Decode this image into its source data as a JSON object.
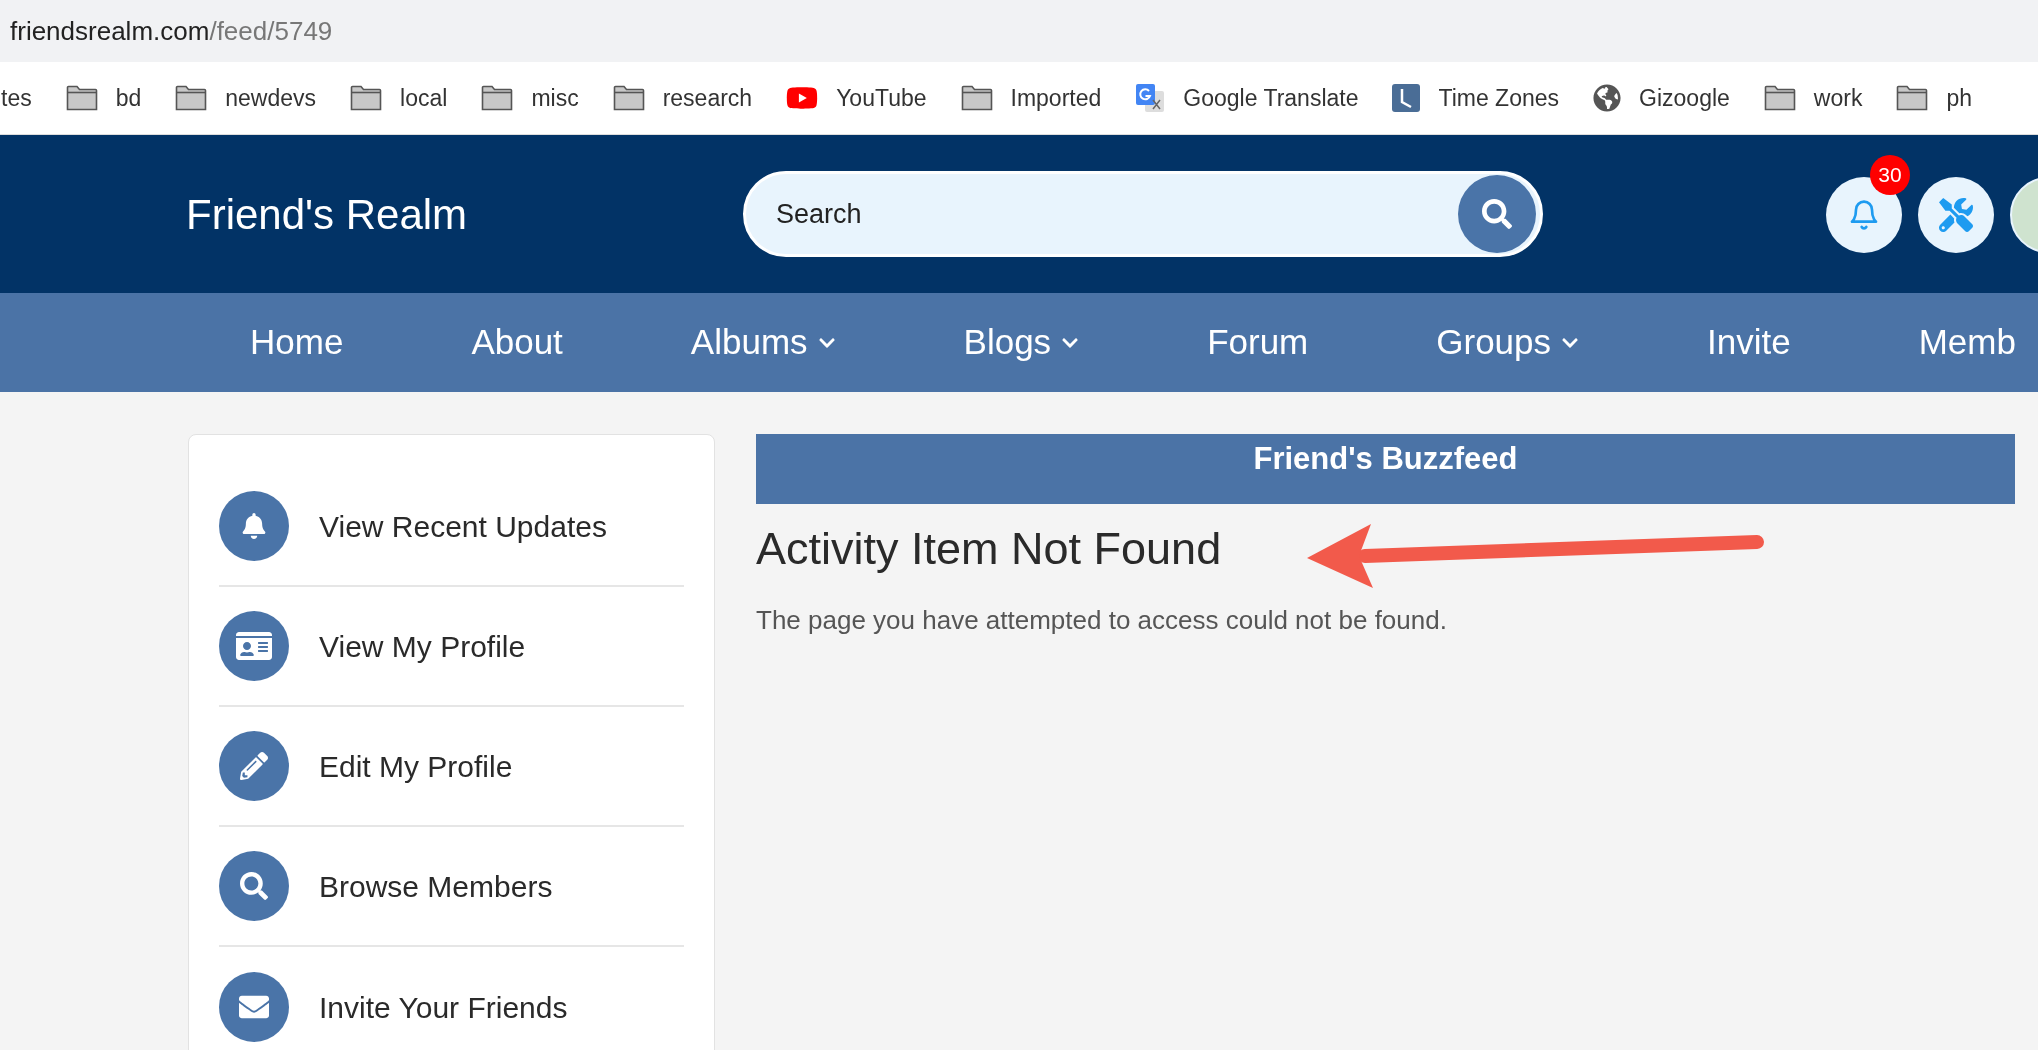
{
  "browser": {
    "url_domain": "friendsrealm.com",
    "url_path": "/feed/5749"
  },
  "bookmarks": [
    {
      "label": "tes",
      "kind": "none"
    },
    {
      "label": "bd",
      "kind": "folder"
    },
    {
      "label": "newdevs",
      "kind": "folder"
    },
    {
      "label": "local",
      "kind": "folder"
    },
    {
      "label": "misc",
      "kind": "folder"
    },
    {
      "label": "research",
      "kind": "folder"
    },
    {
      "label": "YouTube",
      "kind": "video"
    },
    {
      "label": "Imported",
      "kind": "folder"
    },
    {
      "label": "Google Translate",
      "kind": "translate"
    },
    {
      "label": "Time Zones",
      "kind": "clock"
    },
    {
      "label": "Gizoogle",
      "kind": "globe"
    },
    {
      "label": "work",
      "kind": "folder"
    },
    {
      "label": "ph",
      "kind": "folder"
    }
  ],
  "header": {
    "logo": "Friend's Realm",
    "search": {
      "placeholder": "Search"
    },
    "notification_count": "30"
  },
  "nav": [
    {
      "label": "Home",
      "dropdown": false
    },
    {
      "label": "About",
      "dropdown": false
    },
    {
      "label": "Albums",
      "dropdown": true
    },
    {
      "label": "Blogs",
      "dropdown": true
    },
    {
      "label": "Forum",
      "dropdown": false
    },
    {
      "label": "Groups",
      "dropdown": true
    },
    {
      "label": "Invite",
      "dropdown": false
    },
    {
      "label": "Memb",
      "dropdown": false
    }
  ],
  "sidebar": {
    "items": [
      {
        "label": "View Recent Updates",
        "kind": "updates"
      },
      {
        "label": "View My Profile",
        "kind": "profile"
      },
      {
        "label": "Edit My Profile",
        "kind": "edit"
      },
      {
        "label": "Browse Members",
        "kind": "browse"
      },
      {
        "label": "Invite Your Friends",
        "kind": "invite"
      }
    ]
  },
  "main": {
    "banner": "Friend's Buzzfeed",
    "heading": "Activity Item Not Found",
    "message": "The page you have attempted to access could not be found."
  }
}
